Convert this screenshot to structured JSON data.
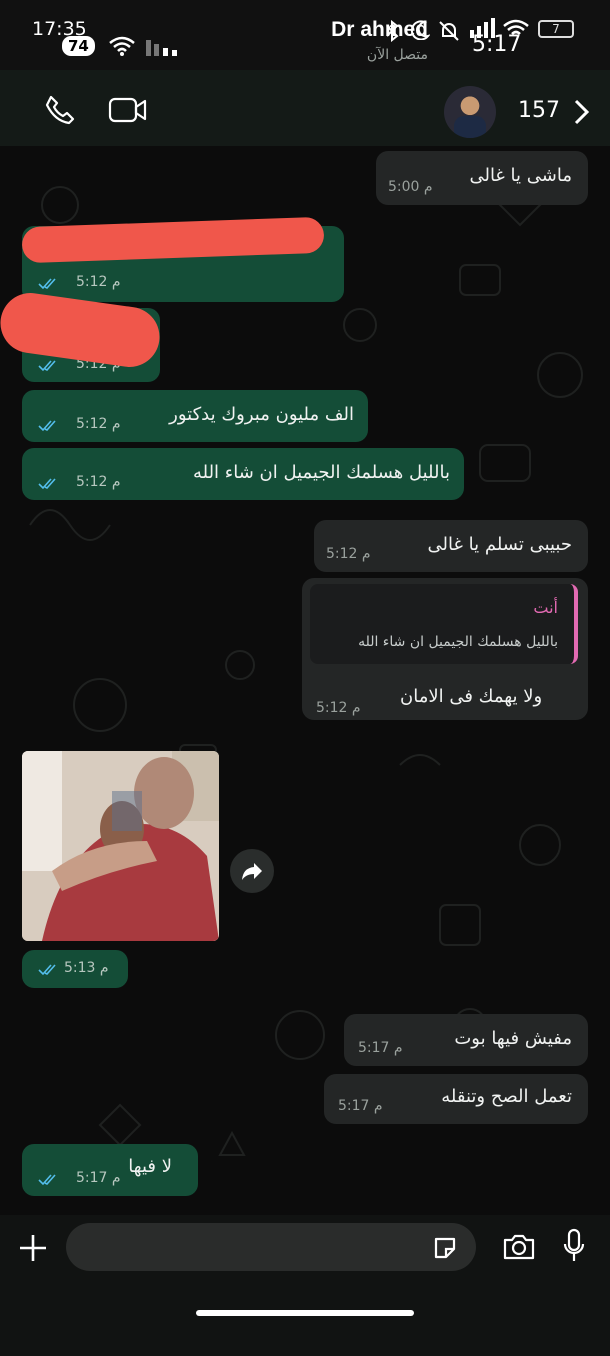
{
  "status_bar": {
    "time": "17:35",
    "notification_count": "74",
    "clock_secondary": "5:17",
    "battery": "7"
  },
  "header": {
    "contact_name": "Dr ahmed",
    "contact_status": "متصل الآن",
    "unread_count": "157"
  },
  "messages": [
    {
      "text": "ماشى يا غالى",
      "time": "5:00 م"
    },
    {
      "text": "",
      "time": "5:12 م"
    },
    {
      "text": "",
      "time": "5:12 م"
    },
    {
      "text": "الف مليون مبروك يدكتور",
      "time": "5:12 م"
    },
    {
      "text": "بالليل هسلمك الجيميل ان شاء الله",
      "time": "5:12 م"
    },
    {
      "text": "حبيبى تسلم يا غالى",
      "time": "5:12 م"
    },
    {
      "text": "ولا يهمك فى الامان",
      "time": "5:12 م",
      "quote_author": "أنت",
      "quote_text": "بالليل هسلمك الجيميل ان شاء الله"
    },
    {
      "text": "",
      "time": "5:13 م"
    },
    {
      "text": "مفيش فيها بوت",
      "time": "5:17 م"
    },
    {
      "text": "تعمل الصح وتنقله",
      "time": "5:17 م"
    },
    {
      "text": "لا فيها",
      "time": "5:17 م"
    }
  ],
  "colors": {
    "outgoing_bubble": "#144d37",
    "incoming_bubble": "#242626",
    "read_ticks": "#53bdeb",
    "quote_accent": "#e26ab2"
  }
}
